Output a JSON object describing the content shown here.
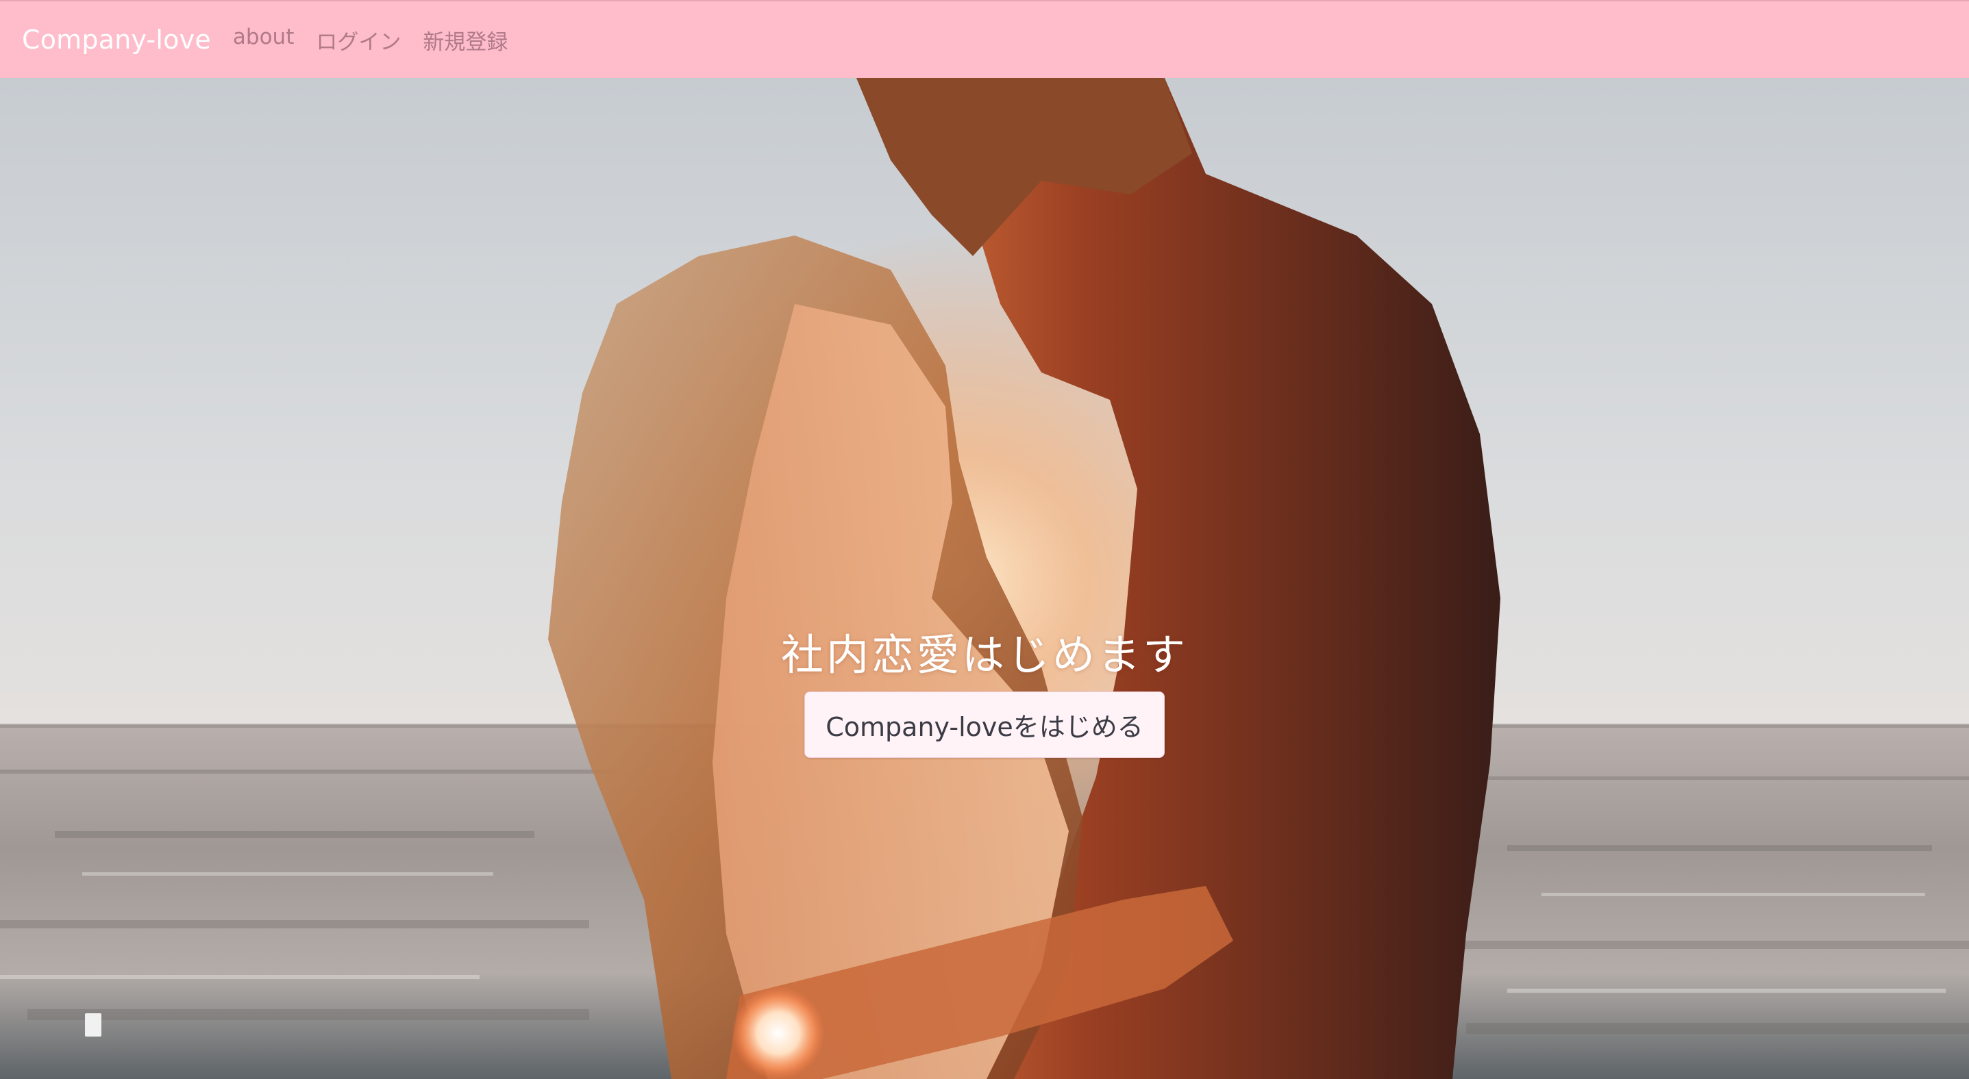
{
  "navbar": {
    "brand": "Company-love",
    "links": [
      {
        "label": "about"
      },
      {
        "label": "ログイン"
      },
      {
        "label": "新規登録"
      }
    ],
    "background_color": "#ffbccb"
  },
  "hero": {
    "title": "社内恋愛はじめます",
    "button_label": "Company-loveをはじめる",
    "photo_subject": "couple-embracing-at-sea-sunset"
  }
}
